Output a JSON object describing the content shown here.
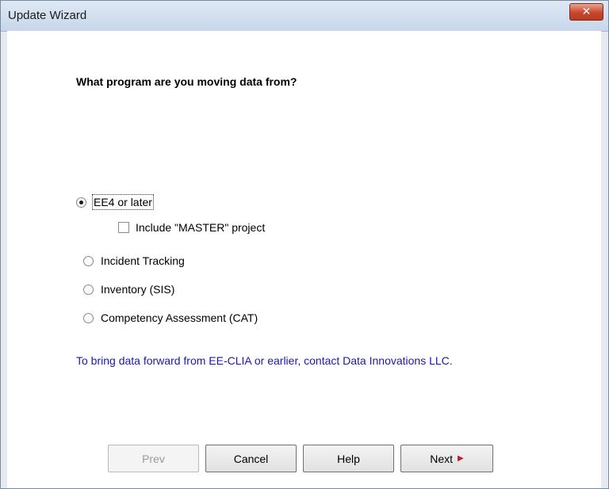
{
  "window": {
    "title": "Update Wizard",
    "close_label": "✕"
  },
  "question": "What program are you moving data from?",
  "options": [
    {
      "label": "EE4 or later",
      "selected": true
    },
    {
      "label": "Incident Tracking",
      "selected": false
    },
    {
      "label": "Inventory (SIS)",
      "selected": false
    },
    {
      "label": "Competency Assessment (CAT)",
      "selected": false
    }
  ],
  "include_master": {
    "label": "Include \"MASTER\" project",
    "checked": false
  },
  "info_text": "To bring data forward from EE-CLIA or earlier, contact Data Innovations LLC.",
  "buttons": {
    "prev": "Prev",
    "cancel": "Cancel",
    "help": "Help",
    "next": "Next",
    "next_arrow": "▶"
  }
}
